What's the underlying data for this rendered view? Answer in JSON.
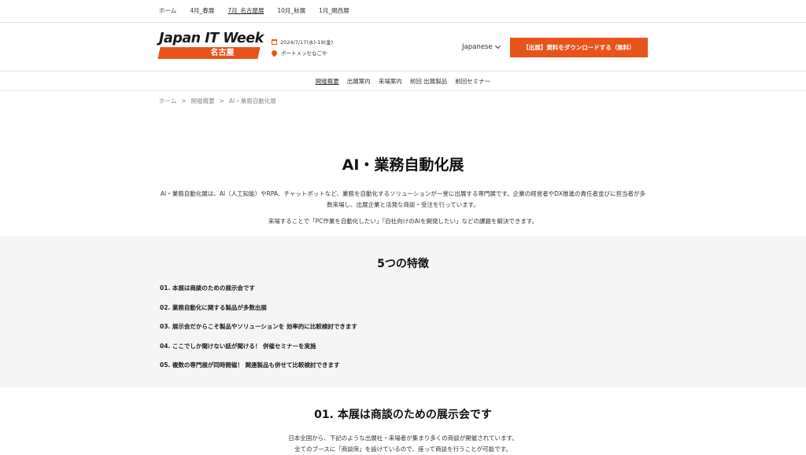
{
  "topnav": [
    "ホーム",
    "4月_春展",
    "7月_名古屋展",
    "10月_秋展",
    "1月_関西展"
  ],
  "header": {
    "logo_text": "Japan IT Week",
    "logo_sub": "名古屋",
    "date": "2024/7/17(水)-19(金)",
    "venue": "ポートメッセなごや",
    "language": "Japanese",
    "cta": "【出展】資料をダウンロードする（無料）"
  },
  "subnav": [
    "開催概要",
    "出展案内",
    "来場案内",
    "前回 出展製品",
    "前回セミナー"
  ],
  "breadcrumb": [
    "ホーム",
    "開催概要",
    "AI・業務自動化展"
  ],
  "hero": {
    "title": "AI・業務自動化展",
    "p1": "AI・業務自動化展は、AI（人工知能）やRPA、チャットボットなど、業務を自動化するソリューションが一堂に出展する専門展です。企業の経営者やDX推進の責任者並びに担当者が多数来場し、出展企業と活発な商談・受注を行っています。",
    "p2": "来場することで「PC作業を自動化したい」「自社向けのAIを開発したい」などの課題を解決できます。"
  },
  "features": {
    "title": "5つの特徴",
    "items": [
      "01. 本展は商談のための展示会です",
      "02. 業務自動化に関する製品が多数出展",
      "03. 展示会だからこそ製品やソリューションを 効率的に比較検討できます",
      "04. ここでしか聞けない話が聞ける！ 併催セミナーを実施",
      "05. 複数の専門展が同時開催！ 関連製品も併せて比較検討できます"
    ]
  },
  "section1": {
    "title": "01. 本展は商談のための展示会です",
    "line1": "日本全国から、下記のような出展社・来場者が集まり多くの商談が開催されています。",
    "line2": "全てのブースに「商談席」を設けているので、座って商談を行うことが可能です。"
  }
}
